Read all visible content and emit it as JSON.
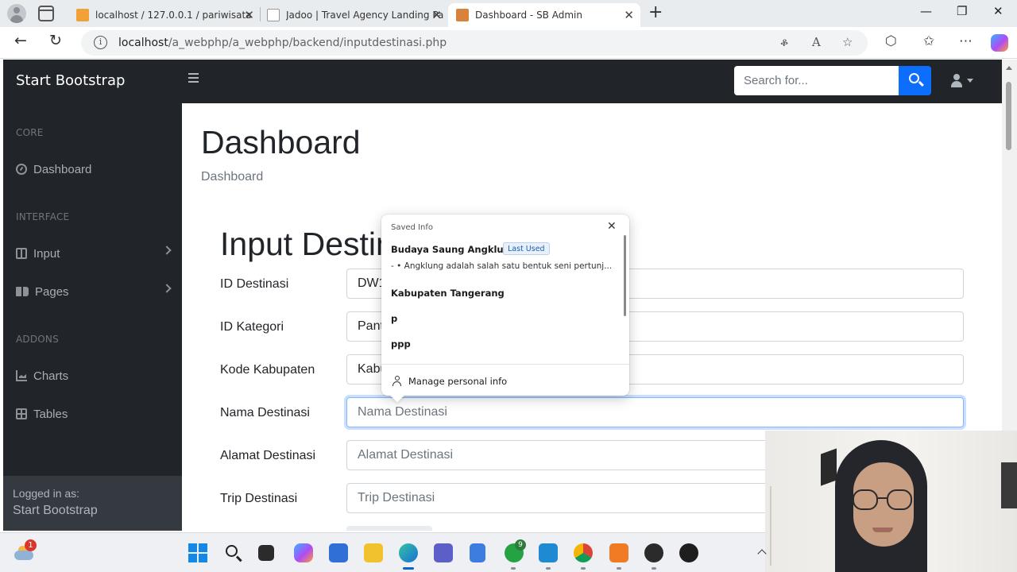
{
  "browser": {
    "tabs": [
      {
        "title": "localhost / 127.0.0.1 / pariwisata /",
        "favicon_color": "#f0a236",
        "active": false
      },
      {
        "title": "Jadoo | Travel Agency Landing Pa",
        "favicon_color": "#222222",
        "active": false
      },
      {
        "title": "Dashboard - SB Admin",
        "favicon_color": "#d9823b",
        "active": true
      }
    ],
    "url_host": "localhost",
    "url_path": "/a_webphp/a_webphp/backend/inputdestinasi.php",
    "icons": [
      "back-icon",
      "refresh-icon",
      "info-icon",
      "read-aloud-icon",
      "favorite-icon",
      "extensions-icon",
      "favorites-bar-icon",
      "more-icon",
      "copilot-icon"
    ]
  },
  "app": {
    "brand": "Start Bootstrap",
    "search_placeholder": "Search for...",
    "sidebar": {
      "sections": [
        {
          "heading": "CORE",
          "items": [
            {
              "label": "Dashboard",
              "icon": "gauge-icon",
              "has_chevron": false
            }
          ]
        },
        {
          "heading": "INTERFACE",
          "items": [
            {
              "label": "Input",
              "icon": "columns-icon",
              "has_chevron": true
            },
            {
              "label": "Pages",
              "icon": "book-icon",
              "has_chevron": true
            }
          ]
        },
        {
          "heading": "ADDONS",
          "items": [
            {
              "label": "Charts",
              "icon": "chart-area-icon",
              "has_chevron": false
            },
            {
              "label": "Tables",
              "icon": "table-icon",
              "has_chevron": false
            }
          ]
        }
      ],
      "footer_label": "Logged in as:",
      "footer_user": "Start Bootstrap"
    },
    "page_title": "Dashboard",
    "breadcrumb": "Dashboard",
    "form_title": "Input Destinasi",
    "fields": [
      {
        "label": "ID Destinasi",
        "value": "DW1",
        "placeholder": ""
      },
      {
        "label": "ID Kategori",
        "value": "Pant",
        "placeholder": ""
      },
      {
        "label": "Kode Kabupaten",
        "value": "Kabu",
        "placeholder": ""
      },
      {
        "label": "Nama Destinasi",
        "value": "",
        "placeholder": "Nama Destinasi"
      },
      {
        "label": "Alamat Destinasi",
        "value": "",
        "placeholder": "Alamat Destinasi"
      },
      {
        "label": "Trip Destinasi",
        "value": "",
        "placeholder": "Trip Destinasi"
      }
    ],
    "accent_color": "#0d6efd",
    "dark_color": "#212529"
  },
  "autofill": {
    "header": "Saved Info",
    "items": [
      {
        "title": "Budaya Saung Angklung",
        "badge": "Last Used",
        "subtitle": "- • Angklung adalah salah satu bentuk seni pertunj..."
      },
      {
        "title": "Kabupaten Tangerang"
      },
      {
        "title": "p"
      },
      {
        "title": "ppp"
      }
    ],
    "manage_label": "Manage personal info"
  },
  "taskbar": {
    "weather_badge": "1",
    "whatsapp_badge": "9",
    "apps": [
      "start-icon",
      "search-icon",
      "task-view-icon",
      "copilot-icon",
      "mail-icon",
      "file-explorer-icon",
      "edge-icon",
      "teams-icon",
      "notepad-icon",
      "whatsapp-icon",
      "vscode-icon",
      "chrome-icon",
      "xampp-icon",
      "obs-icon",
      "media-player-icon"
    ]
  }
}
